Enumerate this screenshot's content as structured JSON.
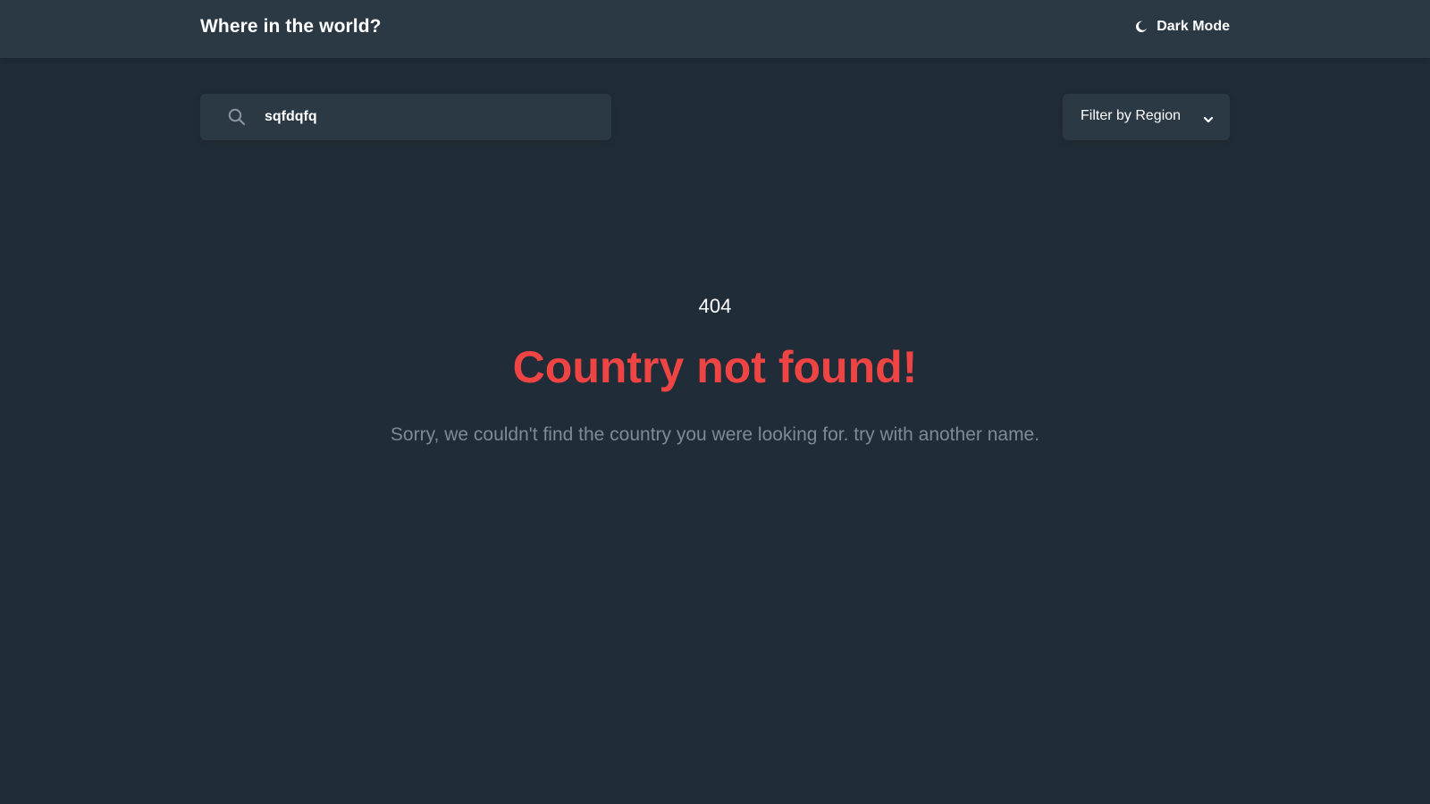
{
  "header": {
    "title": "Where in the world?",
    "theme_toggle": {
      "label": "Dark Mode",
      "icon": "moon-icon"
    }
  },
  "search": {
    "value": "sqfdqfq",
    "placeholder": "",
    "icon": "search-icon"
  },
  "filter": {
    "selected": "Filter by Region",
    "icon": "chevron-down-icon"
  },
  "error": {
    "code": "404",
    "title": "Country not found!",
    "message": "Sorry, we couldn't find the country you were looking for. try with another name."
  },
  "colors": {
    "background": "#202c37",
    "surface": "#2b3945",
    "text": "#ffffff",
    "error": "#ef4444",
    "muted": "#7f8a94"
  }
}
